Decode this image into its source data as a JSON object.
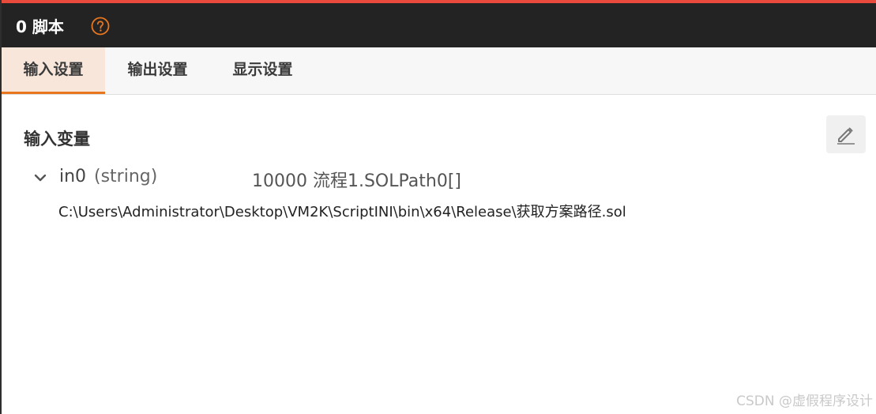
{
  "window": {
    "title": "0 脚本",
    "help_icon": "question-circle-icon",
    "accent_color": "#e8761e",
    "top_stripe_color": "#e84a3c"
  },
  "tabs": [
    {
      "label": "输入设置",
      "active": true
    },
    {
      "label": "输出设置",
      "active": false
    },
    {
      "label": "显示设置",
      "active": false
    }
  ],
  "section": {
    "title": "输入变量",
    "edit_icon": "pencil-icon"
  },
  "variables": [
    {
      "name": "in0",
      "type": "(string)",
      "source": "10000 流程1.SOLPath0[]",
      "value": "C:\\Users\\Administrator\\Desktop\\VM2K\\ScriptINI\\bin\\x64\\Release\\获取方案路径.sol",
      "expanded": true
    }
  ],
  "watermark": "CSDN @虚假程序设计"
}
